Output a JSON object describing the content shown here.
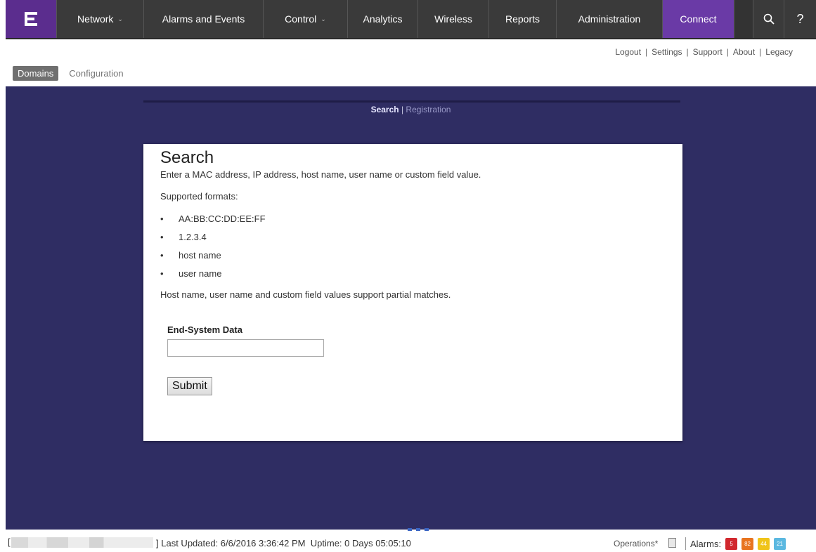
{
  "nav": {
    "logo_icon": "extreme-logo-icon",
    "items": [
      {
        "label": "Network",
        "dropdown": true
      },
      {
        "label": "Alarms and Events",
        "dropdown": false
      },
      {
        "label": "Control",
        "dropdown": true
      },
      {
        "label": "Analytics",
        "dropdown": false
      },
      {
        "label": "Wireless",
        "dropdown": false
      },
      {
        "label": "Reports",
        "dropdown": false
      },
      {
        "label": "Administration",
        "dropdown": false
      },
      {
        "label": "Connect",
        "dropdown": false,
        "active": true
      }
    ],
    "search_icon": "search-icon",
    "help_label": "?"
  },
  "utility": {
    "logout": "Logout",
    "settings": "Settings",
    "support": "Support",
    "about": "About",
    "legacy": "Legacy",
    "separator": "|"
  },
  "subtabs": {
    "domains": "Domains",
    "configuration": "Configuration"
  },
  "mini_nav": {
    "search": "Search",
    "separator": "|",
    "registration": "Registration"
  },
  "card": {
    "title": "Search",
    "intro": "Enter a MAC address, IP address, host name, user name or custom field value.",
    "formats_label": "Supported formats:",
    "formats": [
      "AA:BB:CC:DD:EE:FF",
      "1.2.3.4",
      "host name",
      "user name"
    ],
    "partial_note": "Host name, user name and custom field values support partial matches.",
    "field_label": "End-System Data",
    "field_value": "",
    "submit_label": "Submit"
  },
  "status": {
    "bracket_open": "[",
    "bracket_close": "]",
    "last_updated": "Last Updated: 6/6/2016 3:36:42 PM",
    "uptime": "Uptime: 0 Days 05:05:10",
    "operations": "Operations*",
    "alarms_label": "Alarms:",
    "alarm_badges": [
      {
        "value": "5",
        "color": "#d1282e"
      },
      {
        "value": "82",
        "color": "#e8741f"
      },
      {
        "value": "44",
        "color": "#f0c419"
      },
      {
        "value": "21",
        "color": "#5bb8e0"
      }
    ]
  },
  "colors": {
    "nav_bg": "#3a3a3a",
    "brand_purple": "#5b2d8e",
    "active_purple": "#6a3aa6",
    "main_bg": "#2f2d63"
  }
}
